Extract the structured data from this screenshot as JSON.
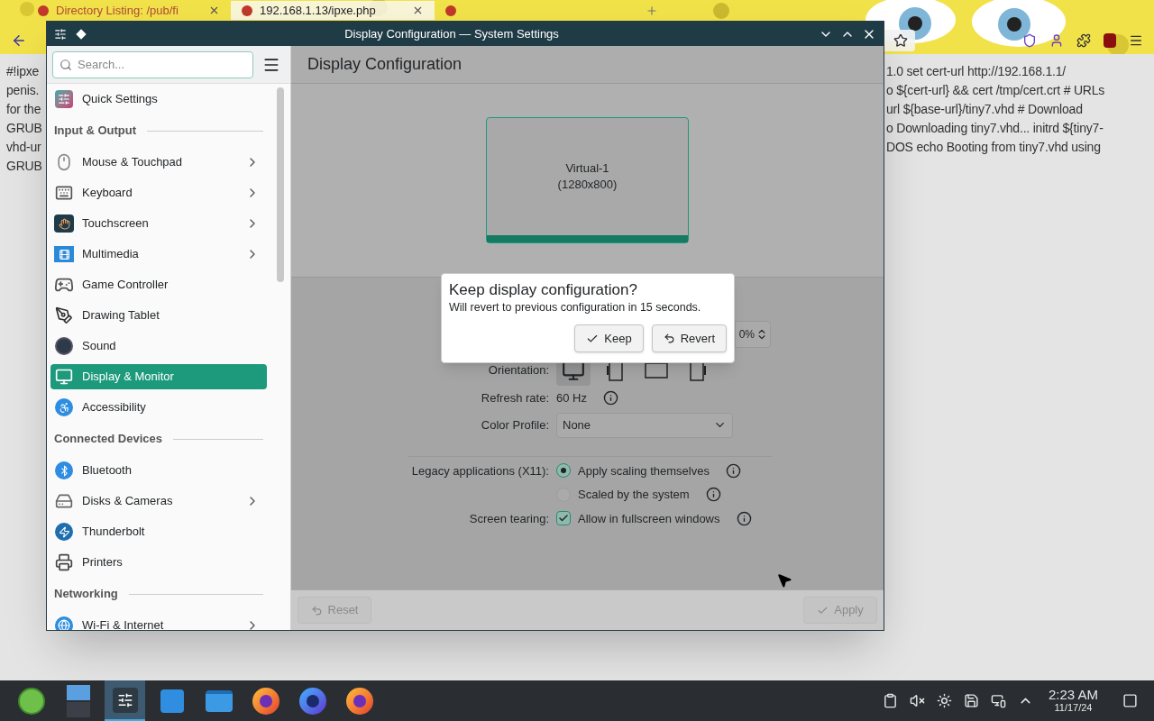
{
  "browser": {
    "tabs": [
      {
        "label": "Directory Listing: /pub/fi",
        "selected": false
      },
      {
        "label": "192.168.1.13/ipxe.php",
        "selected": true
      },
      {
        "selected": false
      }
    ],
    "page_text_left": [
      "#!ipxe",
      "penis.",
      "for the",
      "GRUB",
      "vhd-ur",
      "GRUB"
    ],
    "page_text_right": [
      "1.0 set cert-url http://192.168.1.1/",
      "o ${cert-url} && cert /tmp/cert.crt # URLs",
      "url ${base-url}/tiny7.vhd # Download",
      "o Downloading tiny7.vhd... initrd ${tiny7-",
      "DOS echo Booting from tiny7.vhd using"
    ]
  },
  "window": {
    "title": "Display Configuration — System Settings"
  },
  "search": {
    "placeholder": "Search..."
  },
  "sidebar": {
    "items": [
      {
        "kind": "item",
        "label": "Quick Settings",
        "submenu": false,
        "selected": false
      },
      {
        "kind": "header",
        "label": "Input & Output"
      },
      {
        "kind": "item",
        "label": "Mouse & Touchpad",
        "submenu": true,
        "selected": false
      },
      {
        "kind": "item",
        "label": "Keyboard",
        "submenu": true,
        "selected": false
      },
      {
        "kind": "item",
        "label": "Touchscreen",
        "submenu": true,
        "selected": false
      },
      {
        "kind": "item",
        "label": "Multimedia",
        "submenu": true,
        "selected": false
      },
      {
        "kind": "item",
        "label": "Game Controller",
        "submenu": false,
        "selected": false
      },
      {
        "kind": "item",
        "label": "Drawing Tablet",
        "submenu": false,
        "selected": false
      },
      {
        "kind": "item",
        "label": "Sound",
        "submenu": false,
        "selected": false
      },
      {
        "kind": "item",
        "label": "Display & Monitor",
        "submenu": false,
        "selected": true
      },
      {
        "kind": "item",
        "label": "Accessibility",
        "submenu": false,
        "selected": false
      },
      {
        "kind": "header",
        "label": "Connected Devices"
      },
      {
        "kind": "item",
        "label": "Bluetooth",
        "submenu": false,
        "selected": false
      },
      {
        "kind": "item",
        "label": "Disks & Cameras",
        "submenu": true,
        "selected": false
      },
      {
        "kind": "item",
        "label": "Thunderbolt",
        "submenu": false,
        "selected": false
      },
      {
        "kind": "item",
        "label": "Printers",
        "submenu": false,
        "selected": false
      },
      {
        "kind": "header",
        "label": "Networking"
      },
      {
        "kind": "item",
        "label": "Wi-Fi & Internet",
        "submenu": true,
        "selected": false
      }
    ]
  },
  "main": {
    "title": "Display Configuration",
    "display": {
      "name": "Virtual-1",
      "resolution": "(1280x800)"
    },
    "scale_fragment": "0%",
    "orientation": {
      "label": "Orientation:",
      "options": [
        {
          "selected": true
        },
        {
          "selected": false
        },
        {
          "selected": false
        },
        {
          "selected": false
        }
      ]
    },
    "refresh_rate": {
      "label": "Refresh rate:",
      "value": "60 Hz"
    },
    "color_profile": {
      "label": "Color Profile:",
      "value": "None"
    },
    "legacy": {
      "label": "Legacy applications (X11):",
      "options": [
        {
          "label": "Apply scaling themselves",
          "selected": true
        },
        {
          "label": "Scaled by the system",
          "selected": false
        }
      ]
    },
    "tearing": {
      "label": "Screen tearing:",
      "option": "Allow in fullscreen windows",
      "checked": true
    },
    "footer_buttons": [
      {
        "kind": "reset",
        "label": "Reset",
        "disabled": true
      },
      {
        "kind": "apply",
        "label": "Apply",
        "disabled": true
      }
    ]
  },
  "dialog": {
    "title": "Keep display configuration?",
    "message": "Will revert to previous configuration in 15 seconds.",
    "buttons": [
      {
        "kind": "keep",
        "label": "Keep"
      },
      {
        "kind": "revert",
        "label": "Revert"
      }
    ]
  },
  "taskbar": {
    "apps": [
      {
        "kind": "launcher",
        "active": false
      },
      {
        "kind": "pager",
        "active": false
      },
      {
        "kind": "settings",
        "active": true
      },
      {
        "kind": "store",
        "active": false
      },
      {
        "kind": "files",
        "active": false
      },
      {
        "kind": "browser",
        "active": false
      },
      {
        "kind": "browser-dev",
        "active": false
      },
      {
        "kind": "browser",
        "active": false
      }
    ],
    "clock": {
      "time": "2:23 AM",
      "date": "11/17/24"
    }
  }
}
